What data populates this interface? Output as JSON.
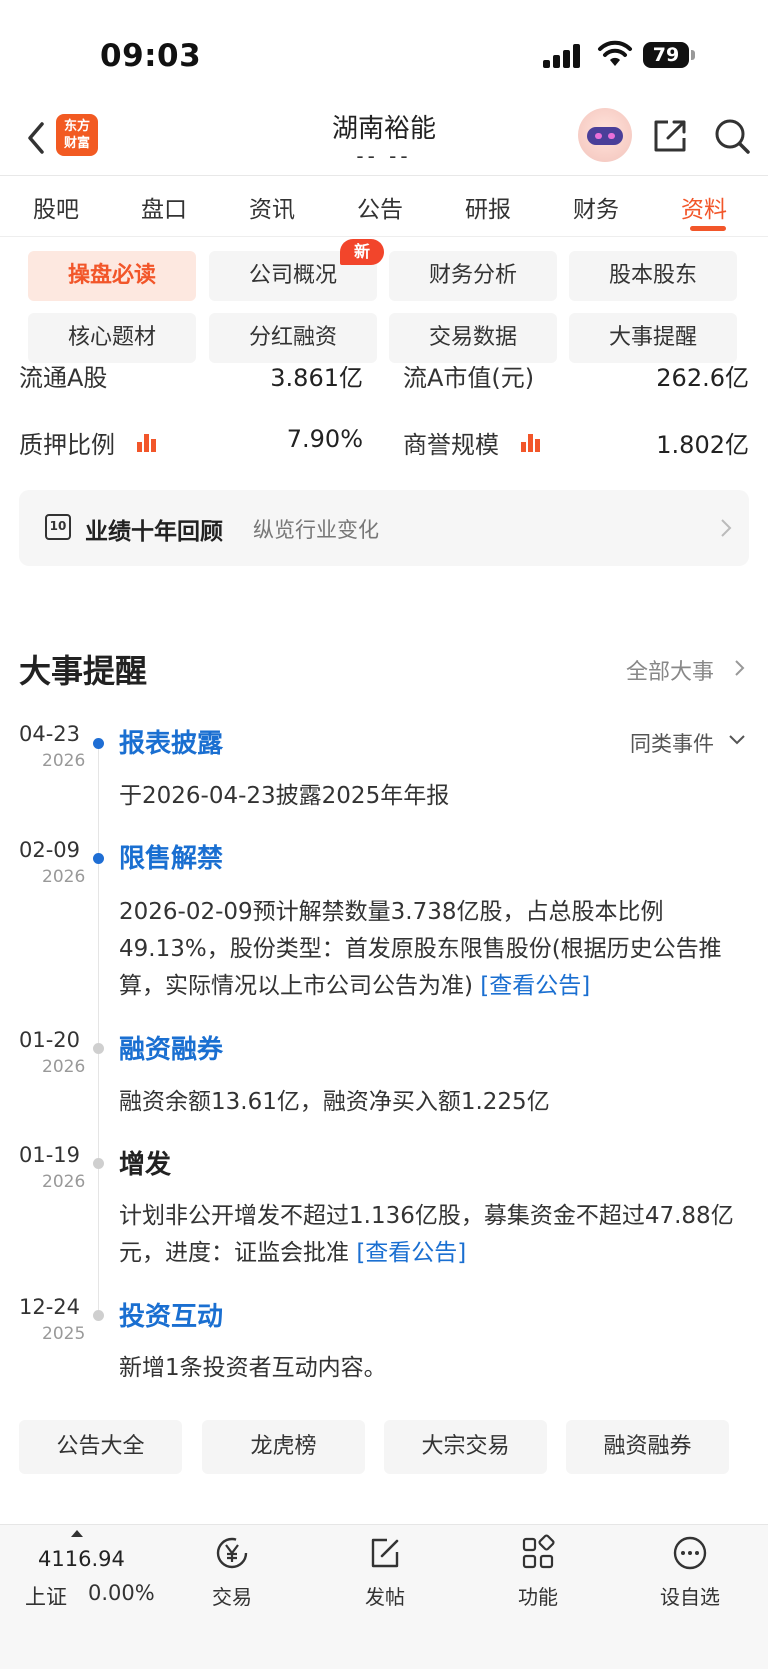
{
  "status_bar": {
    "time": "09:03",
    "battery": "79"
  },
  "header": {
    "logo_line1": "东方",
    "logo_line2": "财富",
    "title": "湖南裕能",
    "subtitle": "-- --"
  },
  "tabs": [
    {
      "label": "股吧"
    },
    {
      "label": "盘口"
    },
    {
      "label": "资讯"
    },
    {
      "label": "公告"
    },
    {
      "label": "研报"
    },
    {
      "label": "财务"
    },
    {
      "label": "资料"
    }
  ],
  "submenu": [
    {
      "label": "操盘必读"
    },
    {
      "label": "公司概况"
    },
    {
      "label": "财务分析"
    },
    {
      "label": "股本股东"
    },
    {
      "label": "核心题材"
    },
    {
      "label": "分红融资"
    },
    {
      "label": "交易数据"
    },
    {
      "label": "大事提醒"
    }
  ],
  "new_badge": "新",
  "metrics": {
    "float_shares_label": "流通A股",
    "float_shares_value": "3.861亿",
    "float_mktcap_label": "流A市值(元)",
    "float_mktcap_value": "262.6亿",
    "pledge_label": "质押比例",
    "pledge_value": "7.90%",
    "goodwill_label": "商誉规模",
    "goodwill_value": "1.802亿"
  },
  "review": {
    "icon_text": "10",
    "title": "业绩十年回顾",
    "subtitle": "纵览行业变化"
  },
  "events_section": {
    "title": "大事提醒",
    "more": "全部大事",
    "similar": "同类事件"
  },
  "events": [
    {
      "date": "04-23",
      "year": "2026",
      "title": "报表披露",
      "text": "于2026-04-23披露2025年年报",
      "link": ""
    },
    {
      "date": "02-09",
      "year": "2026",
      "title": "限售解禁",
      "text": "2026-02-09预计解禁数量3.738亿股，占总股本比例49.13%，股份类型：首发原股东限售股份(根据历史公告推算，实际情况以上市公司公告为准) ",
      "link": "[查看公告]"
    },
    {
      "date": "01-20",
      "year": "2026",
      "title": "融资融券",
      "text": "融资余额13.61亿，融资净买入额1.225亿",
      "link": ""
    },
    {
      "date": "01-19",
      "year": "2026",
      "title": "增发",
      "text": "计划非公开增发不超过1.136亿股，募集资金不超过47.88亿元，进度：证监会批准 ",
      "link": "[查看公告]"
    },
    {
      "date": "12-24",
      "year": "2025",
      "title": "投资互动",
      "text": "新增1条投资者互动内容。",
      "link": ""
    }
  ],
  "quick_links": [
    {
      "label": "公告大全"
    },
    {
      "label": "龙虎榜"
    },
    {
      "label": "大宗交易"
    },
    {
      "label": "融资融券"
    }
  ],
  "bottom_bar": {
    "index_value": "4116.94",
    "index_name": "上证",
    "index_change": "0.00%",
    "nav": [
      {
        "label": "交易"
      },
      {
        "label": "发帖"
      },
      {
        "label": "功能"
      },
      {
        "label": "设自选"
      }
    ]
  },
  "colors": {
    "accent": "#f2562a",
    "link_blue": "#1a6fd1"
  }
}
